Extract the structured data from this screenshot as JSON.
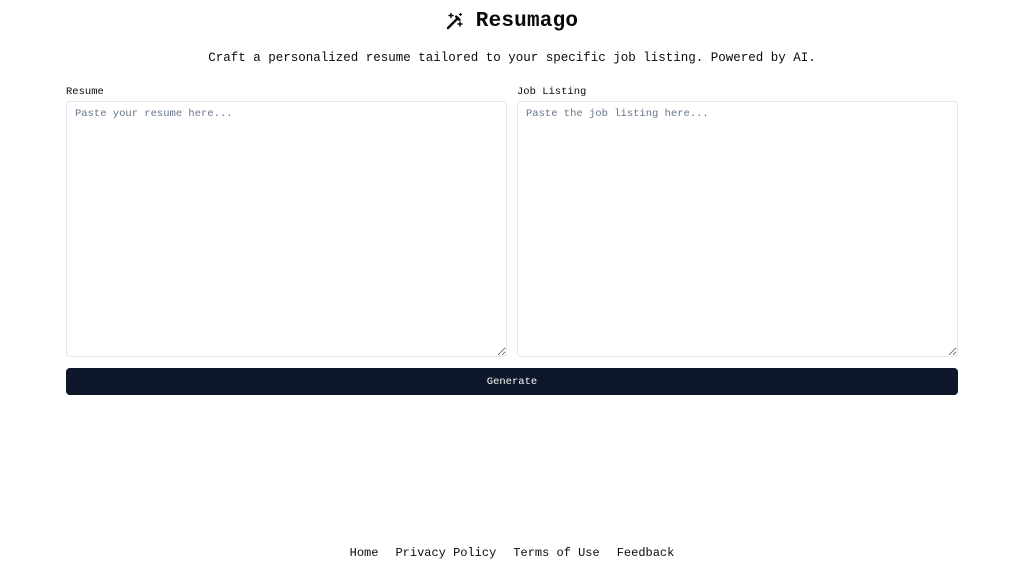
{
  "header": {
    "title": "Resumago",
    "logo_icon": "magic-wand-icon"
  },
  "tagline": "Craft a personalized resume tailored to your specific job listing. Powered by AI.",
  "form": {
    "resume": {
      "label": "Resume",
      "value": "",
      "placeholder": "Paste your resume here..."
    },
    "job_listing": {
      "label": "Job Listing",
      "value": "",
      "placeholder": "Paste the job listing here..."
    },
    "generate_label": "Generate"
  },
  "footer": {
    "links": [
      "Home",
      "Privacy Policy",
      "Terms of Use",
      "Feedback"
    ]
  },
  "colors": {
    "primary": "#0f172a",
    "border": "#e2e8f0",
    "placeholder": "#64748b",
    "background": "#ffffff"
  }
}
